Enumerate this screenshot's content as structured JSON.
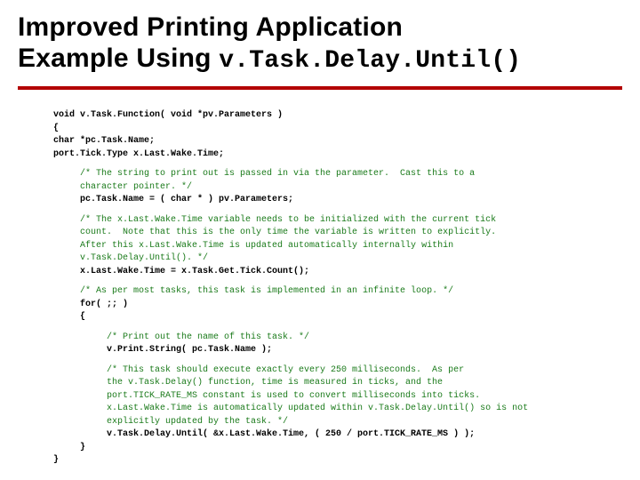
{
  "title_line1": "Improved Printing Application",
  "title_line2_a": "Example Using ",
  "title_line2_b": "v.Task.Delay.Until()",
  "code": {
    "l1": "void v.Task.Function( void *pv.Parameters )",
    "l2": "{",
    "l3": "char *pc.Task.Name;",
    "l4": "port.Tick.Type x.Last.Wake.Time;",
    "c1a": "/* The string to print out is passed in via the parameter.  Cast this to a",
    "c1b": "character pointer. */",
    "l5": "pc.Task.Name = ( char * ) pv.Parameters;",
    "c2a": "/* The x.Last.Wake.Time variable needs to be initialized with the current tick",
    "c2b": "count.  Note that this is the only time the variable is written to explicitly.",
    "c2c": "After this x.Last.Wake.Time is updated automatically internally within",
    "c2d": "v.Task.Delay.Until(). */",
    "l6": "x.Last.Wake.Time = x.Task.Get.Tick.Count();",
    "c3": "/* As per most tasks, this task is implemented in an infinite loop. */",
    "l7": "for( ;; )",
    "l8": "{",
    "c4": "/* Print out the name of this task. */",
    "l9": "v.Print.String( pc.Task.Name );",
    "c5a": "/* This task should execute exactly every 250 milliseconds.  As per",
    "c5b": "the v.Task.Delay() function, time is measured in ticks, and the",
    "c5c": "port.TICK_RATE_MS constant is used to convert milliseconds into ticks.",
    "c5d": "x.Last.Wake.Time is automatically updated within v.Task.Delay.Until() so is not",
    "c5e": "explicitly updated by the task. */",
    "l10": "v.Task.Delay.Until( &x.Last.Wake.Time, ( 250 / port.TICK_RATE_MS ) );",
    "l11": "}",
    "l12": "}"
  }
}
